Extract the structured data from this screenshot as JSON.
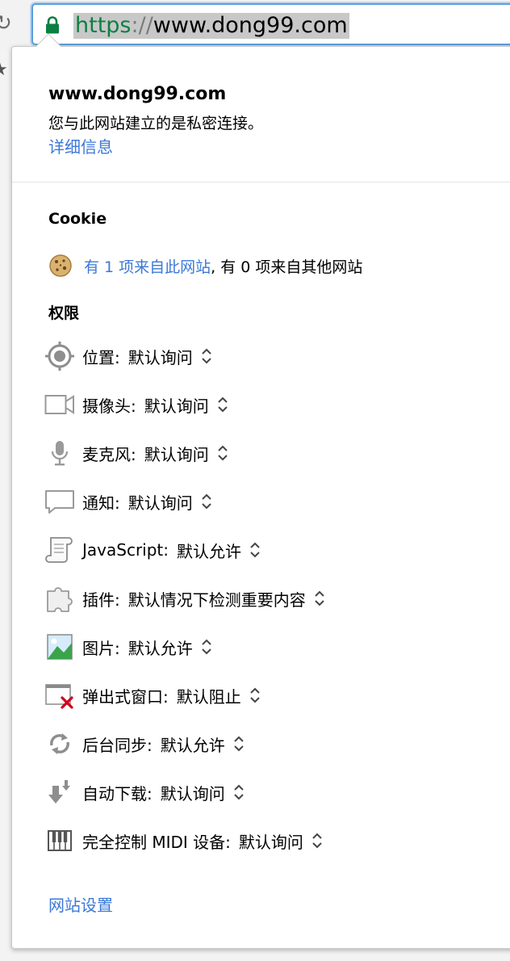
{
  "omnibox": {
    "url_scheme": "https",
    "url_separator": "://",
    "url_host": "www.dong99.com"
  },
  "site_info": {
    "host": "www.dong99.com",
    "connection_description": "您与此网站建立的是私密连接。",
    "details_link": "详细信息"
  },
  "cookies": {
    "section_title": "Cookie",
    "from_site_link": "有 1 项来自此网站",
    "from_other_sites": ", 有 0 项来自其他网站"
  },
  "permissions": {
    "section_title": "权限",
    "items": [
      {
        "icon": "location-icon",
        "label": "位置:",
        "value": "默认询问"
      },
      {
        "icon": "camera-icon",
        "label": "摄像头:",
        "value": "默认询问"
      },
      {
        "icon": "microphone-icon",
        "label": "麦克风:",
        "value": "默认询问"
      },
      {
        "icon": "notification-icon",
        "label": "通知:",
        "value": "默认询问"
      },
      {
        "icon": "javascript-icon",
        "label": "JavaScript:",
        "value": "默认允许"
      },
      {
        "icon": "plugin-icon",
        "label": "插件:",
        "value": "默认情况下检测重要内容"
      },
      {
        "icon": "image-icon",
        "label": "图片:",
        "value": "默认允许"
      },
      {
        "icon": "popup-icon",
        "label": "弹出式窗口:",
        "value": "默认阻止"
      },
      {
        "icon": "background-sync-icon",
        "label": "后台同步:",
        "value": "默认允许"
      },
      {
        "icon": "download-icon",
        "label": "自动下载:",
        "value": "默认询问"
      },
      {
        "icon": "midi-icon",
        "label": "完全控制 MIDI 设备:",
        "value": "默认询问"
      }
    ]
  },
  "footer": {
    "site_settings_link": "网站设置"
  },
  "colors": {
    "link": "#3b78d8",
    "secure_scheme": "#0b8043",
    "omnibox_focus": "#5b9dd9"
  }
}
